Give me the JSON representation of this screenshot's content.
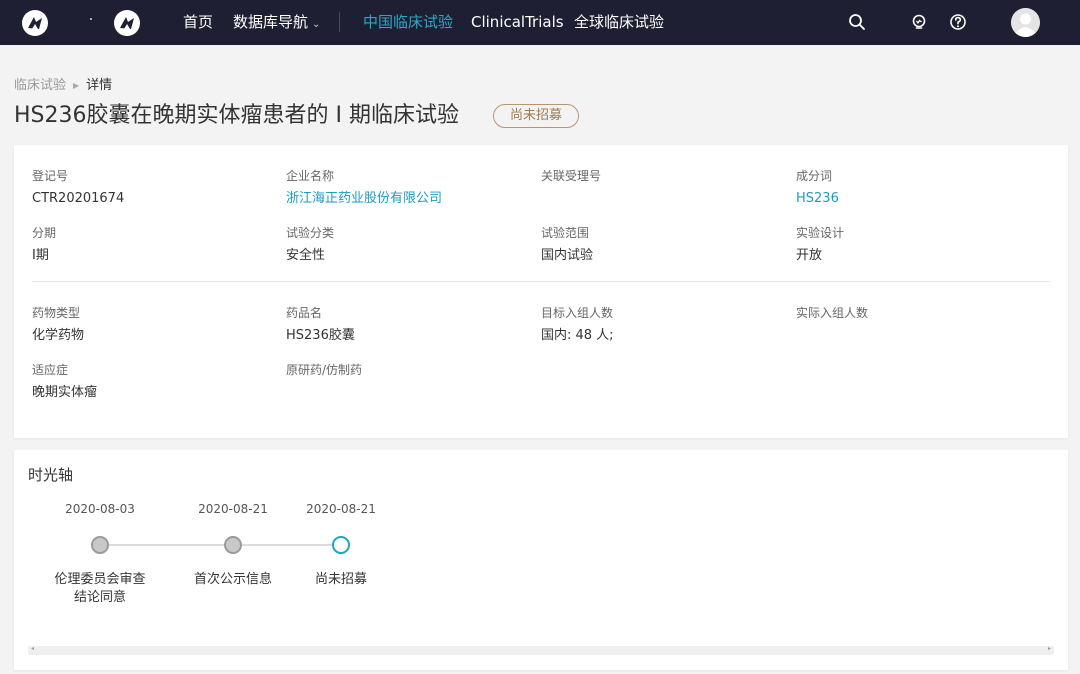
{
  "nav": {
    "items": [
      {
        "label": "首页"
      },
      {
        "label": "数据库导航"
      },
      {
        "label": "中国临床试验"
      },
      {
        "label": "ClinicalTrials"
      },
      {
        "label": "全球临床试验"
      }
    ],
    "caret": "⌄",
    "icons": [
      "logo-icon",
      "search-icon",
      "lightbulb-icon",
      "help-icon",
      "user-avatar-icon"
    ],
    "accent_color": "#2aa9c6",
    "background_color": "#1f1f33"
  },
  "breadcrumb": {
    "parent": "临床试验",
    "separator": "▶",
    "current": "详情"
  },
  "title": "HS236胶囊在晚期实体瘤患者的 I 期临床试验",
  "status_badge": "尚未招募",
  "info": {
    "registration_no": {
      "label": "登记号",
      "value": "CTR20201674"
    },
    "company": {
      "label": "企业名称",
      "value": "浙江海正药业股份有限公司"
    },
    "related_acceptance_no": {
      "label": "关联受理号",
      "value": ""
    },
    "ingredient": {
      "label": "成分词",
      "value": "HS236"
    },
    "phase": {
      "label": "分期",
      "value": "I期"
    },
    "trial_category": {
      "label": "试验分类",
      "value": "安全性"
    },
    "trial_scope": {
      "label": "试验范围",
      "value": "国内试验"
    },
    "design": {
      "label": "实验设计",
      "value": "开放"
    },
    "drug_type": {
      "label": "药物类型",
      "value": "化学药物"
    },
    "drug_name": {
      "label": "药品名",
      "value": "HS236胶囊"
    },
    "target_enrollment": {
      "label": "目标入组人数",
      "value": "国内: 48 人;"
    },
    "actual_enrollment": {
      "label": "实际入组人数",
      "value": ""
    },
    "indication": {
      "label": "适应症",
      "value": "晚期实体瘤"
    },
    "original_generic": {
      "label": "原研药/仿制药",
      "value": ""
    }
  },
  "timeline": {
    "title": "时光轴",
    "events": [
      {
        "date": "2020-08-03",
        "label": "伦理委员会审查\n结论同意",
        "state": "done"
      },
      {
        "date": "2020-08-21",
        "label": "首次公示信息",
        "state": "done"
      },
      {
        "date": "2020-08-21",
        "label": "尚未招募",
        "state": "current"
      }
    ],
    "current_color": "#18aac2"
  },
  "scrollbar": {
    "left_arrow": "◂",
    "right_arrow": "▸"
  }
}
